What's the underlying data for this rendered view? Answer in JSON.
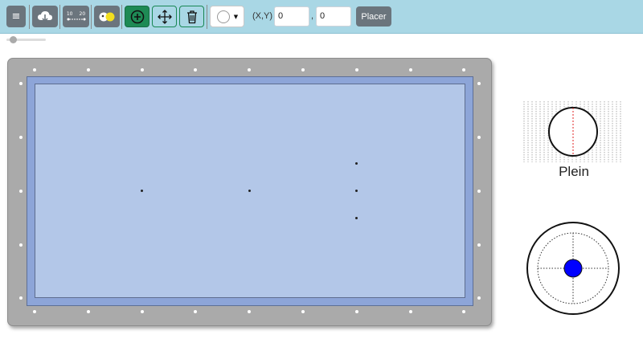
{
  "toolbar": {
    "buttons": [
      {
        "name": "menu-button",
        "icon": "hamburger-icon"
      },
      {
        "name": "cloud-download-button",
        "icon": "cloud-download-icon"
      },
      {
        "name": "measure-button",
        "icon": "ruler-icon",
        "label_a": "10",
        "label_b": "20"
      },
      {
        "name": "toggle-balls-button",
        "icon": "balls-icon"
      },
      {
        "name": "add-ball-button",
        "icon": "plus-circle-icon"
      },
      {
        "name": "move-button",
        "icon": "arrows-move-icon"
      },
      {
        "name": "delete-button",
        "icon": "trash-icon"
      },
      {
        "name": "ball-color-dropdown",
        "icon": "white-ball-icon"
      }
    ],
    "xy_label": "(X,Y)",
    "x_value": "0",
    "comma": ",",
    "y_value": "0",
    "place_label": "Placer"
  },
  "zoom": {
    "level": 0.1
  },
  "side_panel": {
    "spin_label": "Plein",
    "colors": {
      "ball_fill": "#ffffff",
      "cue_dot": "#0000ff",
      "aim_line": "#ff0000"
    }
  },
  "colors": {
    "toolbar": "#a9d7e5",
    "frame": "#aaaaaa",
    "cushion": "#8da5d8",
    "felt": "#b3c7e8"
  }
}
